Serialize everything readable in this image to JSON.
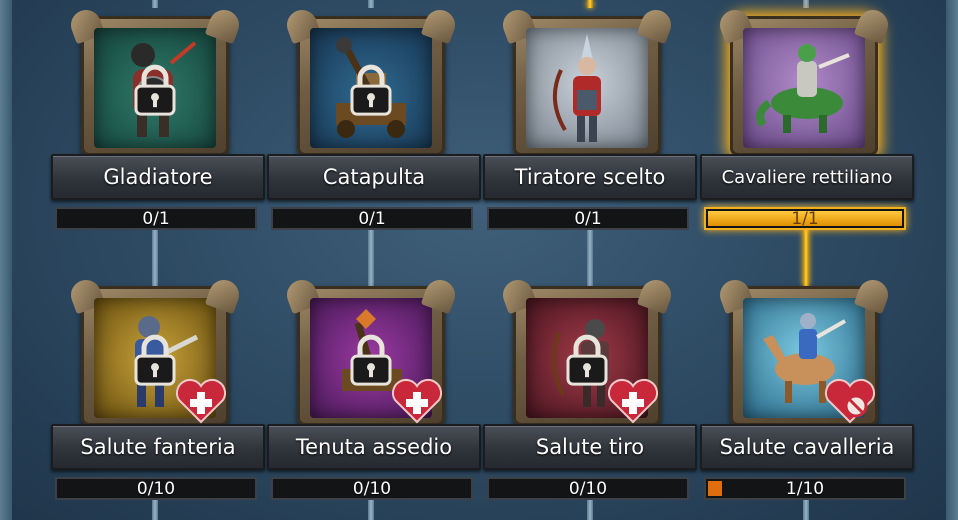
{
  "colors": {
    "active_glow": "#ffb11a",
    "progress_fill": "#f0b020",
    "partial_fill": "#e06e0e",
    "connector": "#8aa4b6"
  },
  "rows": [
    {
      "nodes": [
        {
          "id": "gladiatore",
          "label": "Gladiatore",
          "progress": "0/1",
          "locked": true,
          "active": false,
          "heart": false,
          "portrait_bg": "#1e5a4e",
          "unit": "gladiator"
        },
        {
          "id": "catapulta",
          "label": "Catapulta",
          "progress": "0/1",
          "locked": true,
          "active": false,
          "heart": false,
          "portrait_bg": "#234b6a",
          "unit": "catapult"
        },
        {
          "id": "tiratore",
          "label": "Tiratore scelto",
          "progress": "0/1",
          "locked": false,
          "active": false,
          "heart": false,
          "portrait_bg": "#9ba5b0",
          "unit": "archer"
        },
        {
          "id": "cavaliere",
          "label": "Cavaliere rettiliano",
          "progress": "1/1",
          "locked": false,
          "active": true,
          "heart": false,
          "portrait_bg": "#8a6aa8",
          "unit": "lizard-rider",
          "fill_fraction": 1.0
        }
      ]
    },
    {
      "nodes": [
        {
          "id": "salute-fanteria",
          "label": "Salute fanteria",
          "progress": "0/10",
          "locked": true,
          "active": false,
          "heart": true,
          "portrait_bg": "#a88a1e",
          "unit": "infantry"
        },
        {
          "id": "tenuta-assedio",
          "label": "Tenuta assedio",
          "progress": "0/10",
          "locked": true,
          "active": false,
          "heart": true,
          "portrait_bg": "#6a2c6e",
          "unit": "siege"
        },
        {
          "id": "salute-tiro",
          "label": "Salute tiro",
          "progress": "0/10",
          "locked": true,
          "active": false,
          "heart": true,
          "portrait_bg": "#7a2a36",
          "unit": "ranged"
        },
        {
          "id": "salute-cavalleria",
          "label": "Salute cavalleria",
          "progress": "1/10",
          "locked": false,
          "active": false,
          "heart": true,
          "portrait_bg": "#4aa0c0",
          "unit": "cavalry",
          "fill_fraction": 0.1
        }
      ]
    }
  ]
}
